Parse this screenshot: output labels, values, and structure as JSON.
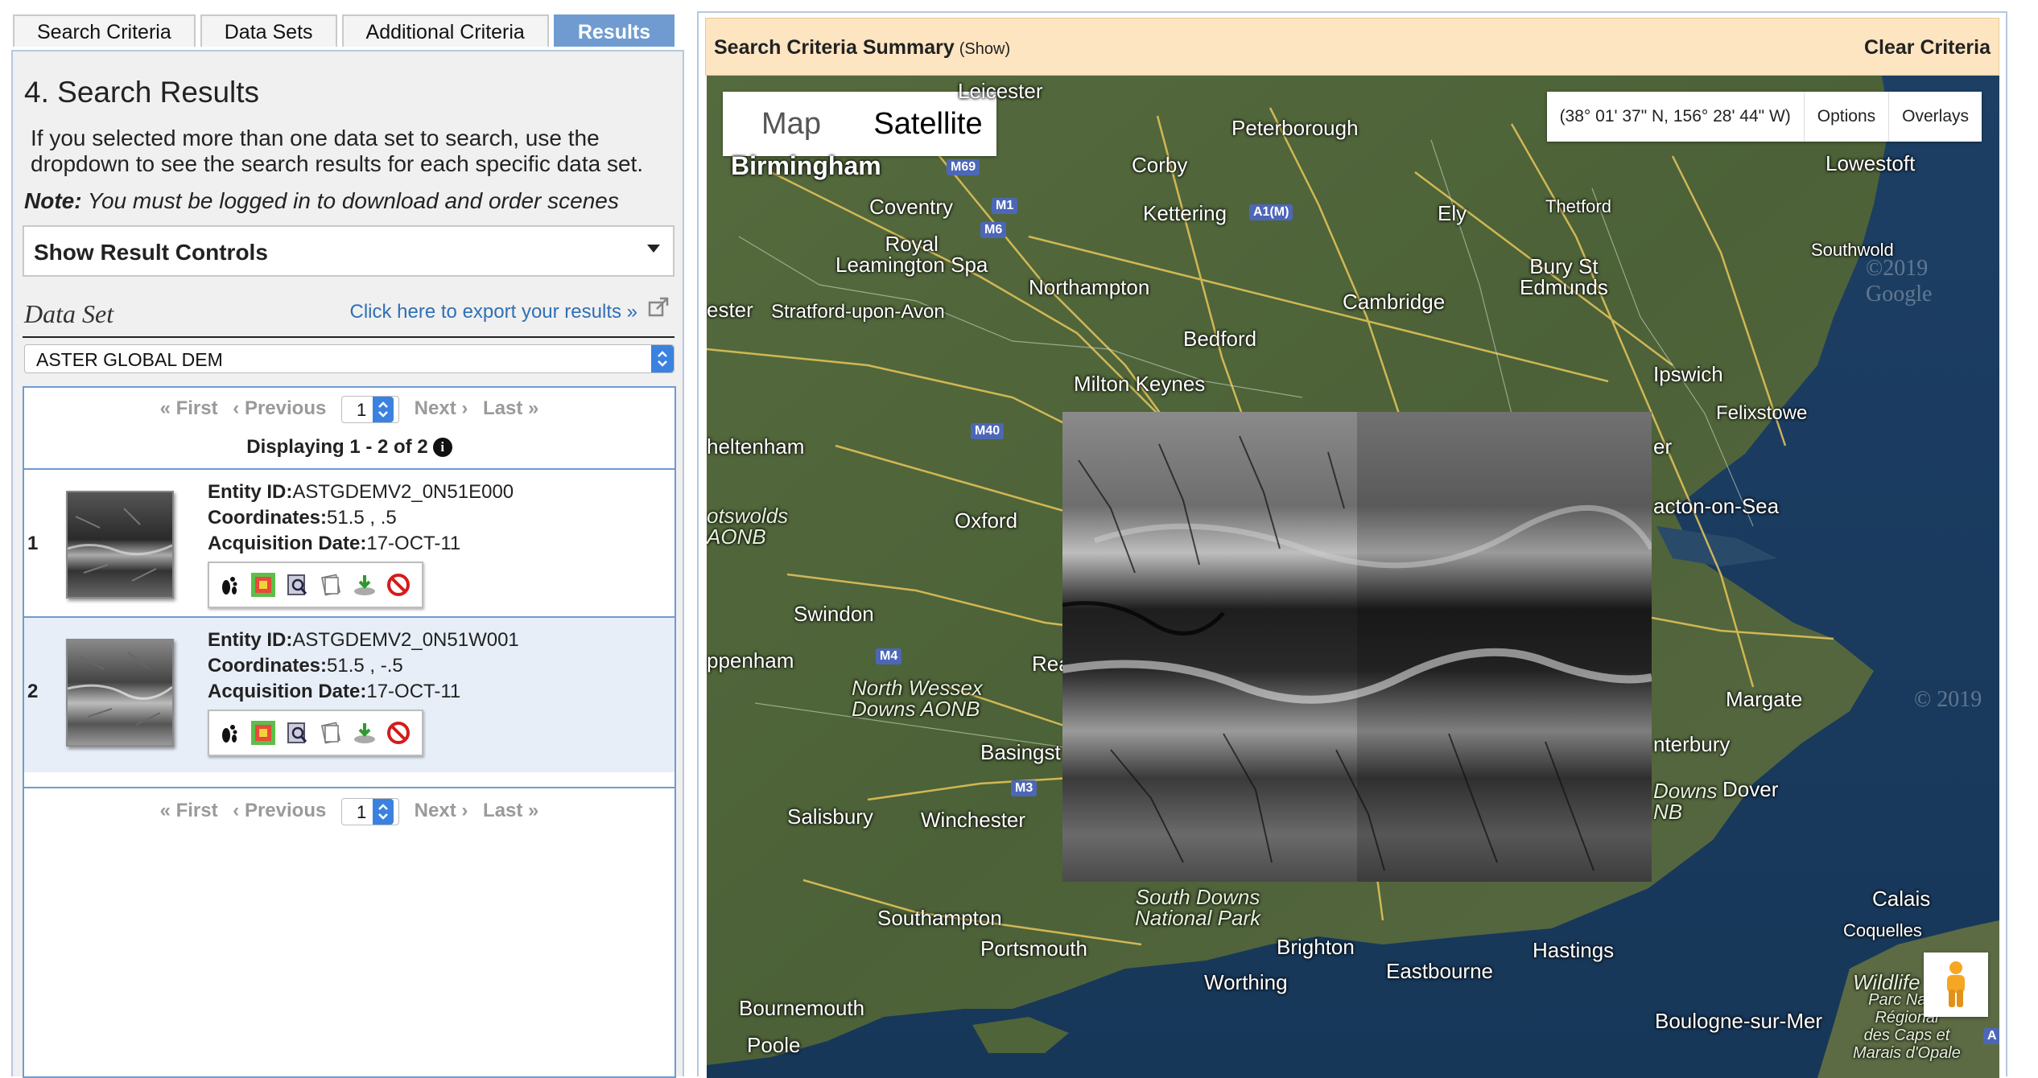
{
  "tabs": [
    {
      "label": "Search Criteria"
    },
    {
      "label": "Data Sets"
    },
    {
      "label": "Additional Criteria"
    },
    {
      "label": "Results"
    }
  ],
  "results_panel": {
    "title": "4. Search Results",
    "description": "If you selected more than one data set to search, use the dropdown to see the search results for each specific data set.",
    "note_label": "Note:",
    "note_text": "You must be logged in to download and order scenes",
    "result_controls_label": "Show Result Controls",
    "data_set_label": "Data Set",
    "export_link": "Click here to export your results »",
    "data_set_value": "ASTER GLOBAL DEM",
    "pager": {
      "first": "« First",
      "previous": "‹ Previous",
      "page": "1",
      "next": "Next ›",
      "last": "Last »"
    },
    "displaying": "Displaying 1 - 2 of 2",
    "rows": [
      {
        "num": "1",
        "entity_label": "Entity ID:",
        "entity_id": "ASTGDEMV2_0N51E000",
        "coords_label": "Coordinates:",
        "coords": "51.5 , .5",
        "date_label": "Acquisition Date:",
        "date": "17-OCT-11"
      },
      {
        "num": "2",
        "entity_label": "Entity ID:",
        "entity_id": "ASTGDEMV2_0N51W001",
        "coords_label": "Coordinates:",
        "coords": "51.5 , -.5",
        "date_label": "Acquisition Date:",
        "date": "17-OCT-11"
      }
    ],
    "row_icons": [
      "footprint-icon",
      "browse-overlay-icon",
      "metadata-icon",
      "compare-icon",
      "download-icon",
      "exclude-icon"
    ]
  },
  "map_panel": {
    "summary_title": "Search Criteria Summary",
    "summary_show": "(Show)",
    "clear_criteria": "Clear Criteria",
    "map_type": {
      "map": "Map",
      "satellite": "Satellite"
    },
    "coordinates": "(38° 01' 37\" N, 156° 28' 44\" W)",
    "options": "Options",
    "overlays": "Overlays",
    "watermark_1": "©2019 Google",
    "watermark_2": "© 2019",
    "places": {
      "leicester": "Leicester",
      "peterborough": "Peterborough",
      "birmingham": "Birmingham",
      "corby": "Corby",
      "lowestoft": "Lowestoft",
      "coventry": "Coventry",
      "kettering": "Kettering",
      "ely": "Ely",
      "thetford": "Thetford",
      "royal_leamington": "Royal\nLeamington Spa",
      "southwold": "Southwold",
      "bury": "Bury St\nEdmunds",
      "northampton": "Northampton",
      "cambridge": "Cambridge",
      "ester": "ester",
      "stratford": "Stratford-upon-Avon",
      "bedford": "Bedford",
      "ipswich": "Ipswich",
      "milton_keynes": "Milton Keynes",
      "felixstowe": "Felixstowe",
      "cheltenham": "heltenham",
      "er": "er",
      "cotswolds": "otswolds\nAONB",
      "oxford": "Oxford",
      "clacton": "acton-on-Sea",
      "swindon": "Swindon",
      "chippenham": "ppenham",
      "reading": "Rea",
      "north_wessex": "North Wessex\nDowns AONB",
      "margate": "Margate",
      "basingstoke": "Basingst",
      "canterbury": "nterbury",
      "downs": "Downs",
      "nb": "NB",
      "dover": "Dover",
      "salisbury": "Salisbury",
      "winchester": "Winchester",
      "south_downs": "South Downs\nNational Park",
      "calais": "Calais",
      "southampton": "Southampton",
      "coquelles": "Coquelles",
      "portsmouth": "Portsmouth",
      "brighton": "Brighton",
      "hastings": "Hastings",
      "eastbourne": "Eastbourne",
      "worthing": "Worthing",
      "wildlife": "Wildlife",
      "parc": "Parc Natur\nRégional\ndes Caps et\nMarais d'Opale",
      "bournemouth": "Bournemouth",
      "boulogne": "Boulogne-sur-Mer",
      "poole": "Poole"
    },
    "roads": {
      "m69": "M69",
      "m1": "M1",
      "m6": "M6",
      "a1m": "A1(M)",
      "m40": "M40",
      "m4": "M4",
      "m3": "M3",
      "a_right": "A"
    }
  },
  "colors": {
    "tab_active": "#6f9bd1",
    "summary_bg": "#fde5c2",
    "link": "#2f6fb6",
    "select_spinner": "#3b82e0"
  }
}
